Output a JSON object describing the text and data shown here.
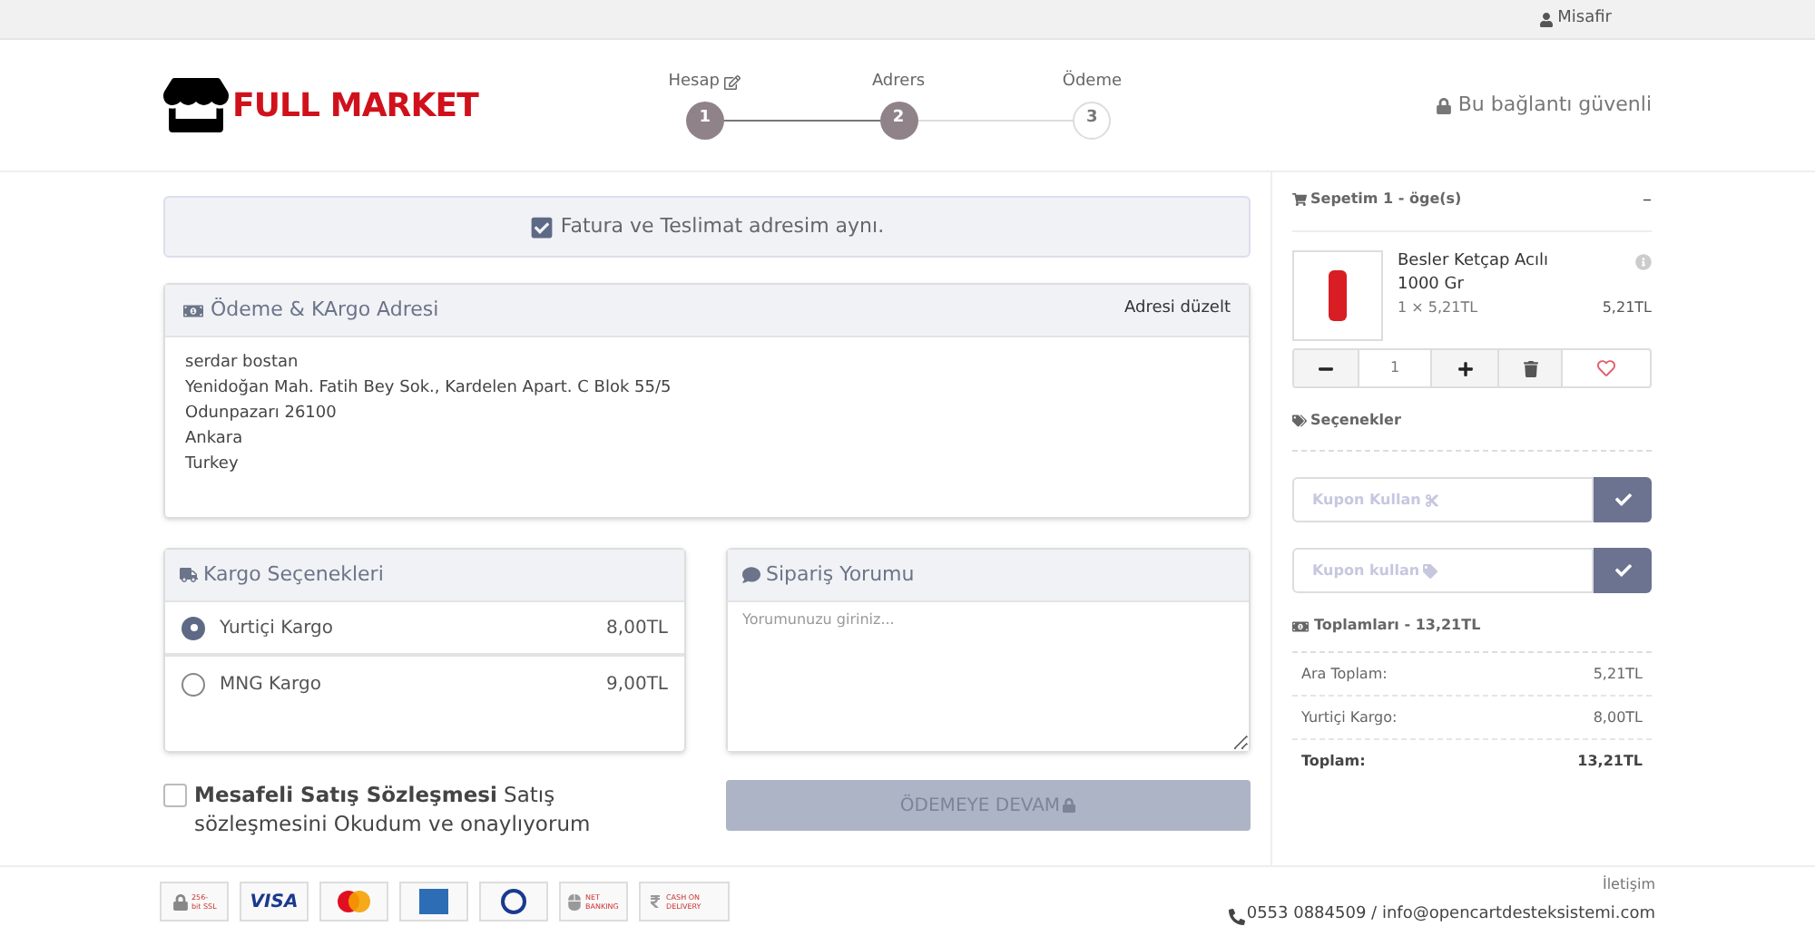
{
  "top_bar": {
    "user": "Misafir"
  },
  "header": {
    "logo": "FULL MARKET",
    "secure": "Bu bağlantı güvenli",
    "steps": [
      {
        "label": "Hesap",
        "number": "1",
        "done": true,
        "editable": true
      },
      {
        "label": "Adrers",
        "number": "2",
        "done": true,
        "editable": false
      },
      {
        "label": "Ödeme",
        "number": "3",
        "done": false,
        "editable": false
      }
    ]
  },
  "same_address": {
    "label": "Fatura ve Teslimat adresim aynı.",
    "checked": true
  },
  "address": {
    "title": "Ödeme & KArgo Adresi",
    "edit": "Adresi düzelt",
    "lines": [
      "serdar bostan",
      "Yenidoğan Mah. Fatih Bey Sok., Kardelen Apart. C Blok 55/5",
      "Odunpazarı 26100",
      "Ankara",
      "Turkey"
    ]
  },
  "shipping": {
    "title": "Kargo Seçenekleri",
    "options": [
      {
        "name": "Yurtiçi Kargo",
        "price": "8,00TL",
        "selected": true
      },
      {
        "name": "MNG Kargo",
        "price": "9,00TL",
        "selected": false
      }
    ]
  },
  "comment": {
    "title": "Sipariş Yorumu",
    "placeholder": "Yorumunuzu giriniz..."
  },
  "agreement": {
    "text": "**Mesafeli Satış Sözleşmesi** Satış sözleşmesini Okudum ve onaylıyorum",
    "checked": false
  },
  "continue_button": {
    "label": "ÖDEMEYE DEVAM",
    "disabled": true
  },
  "cart": {
    "title": "Sepetim 1 - öge(s)",
    "collapse": "–",
    "items": [
      {
        "name": "Besler Ketçap Acılı 1000 Gr",
        "unit": "1 × 5,21TL",
        "total": "5,21TL",
        "quantity": "1"
      }
    ],
    "options_title": "Seçenekler",
    "coupons": [
      {
        "placeholder": "Kupon Kullan",
        "kind": "scissors"
      },
      {
        "placeholder": "Kupon kullan",
        "kind": "tag"
      }
    ],
    "totals_title": "Toplamları - 13,21TL",
    "totals": [
      {
        "label": "Ara Toplam:",
        "value": "5,21TL",
        "bold": false
      },
      {
        "label": "Yurtiçi Kargo:",
        "value": "8,00TL",
        "bold": false
      },
      {
        "label": "Toplam:",
        "value": "13,21TL",
        "bold": true
      }
    ]
  },
  "footer": {
    "payments": [
      {
        "kind": "ssl",
        "text": "256-bit SSL"
      },
      {
        "kind": "visa",
        "text": "VISA"
      },
      {
        "kind": "mastercard"
      },
      {
        "kind": "amex"
      },
      {
        "kind": "diners"
      },
      {
        "kind": "netbanking",
        "text": "NET BANKING"
      },
      {
        "kind": "cod",
        "text": "CASH ON DELIVERY"
      }
    ],
    "contact_title": "İletişim",
    "contact": "0553 0884509 / info@opencartdesteksistemi.com"
  }
}
